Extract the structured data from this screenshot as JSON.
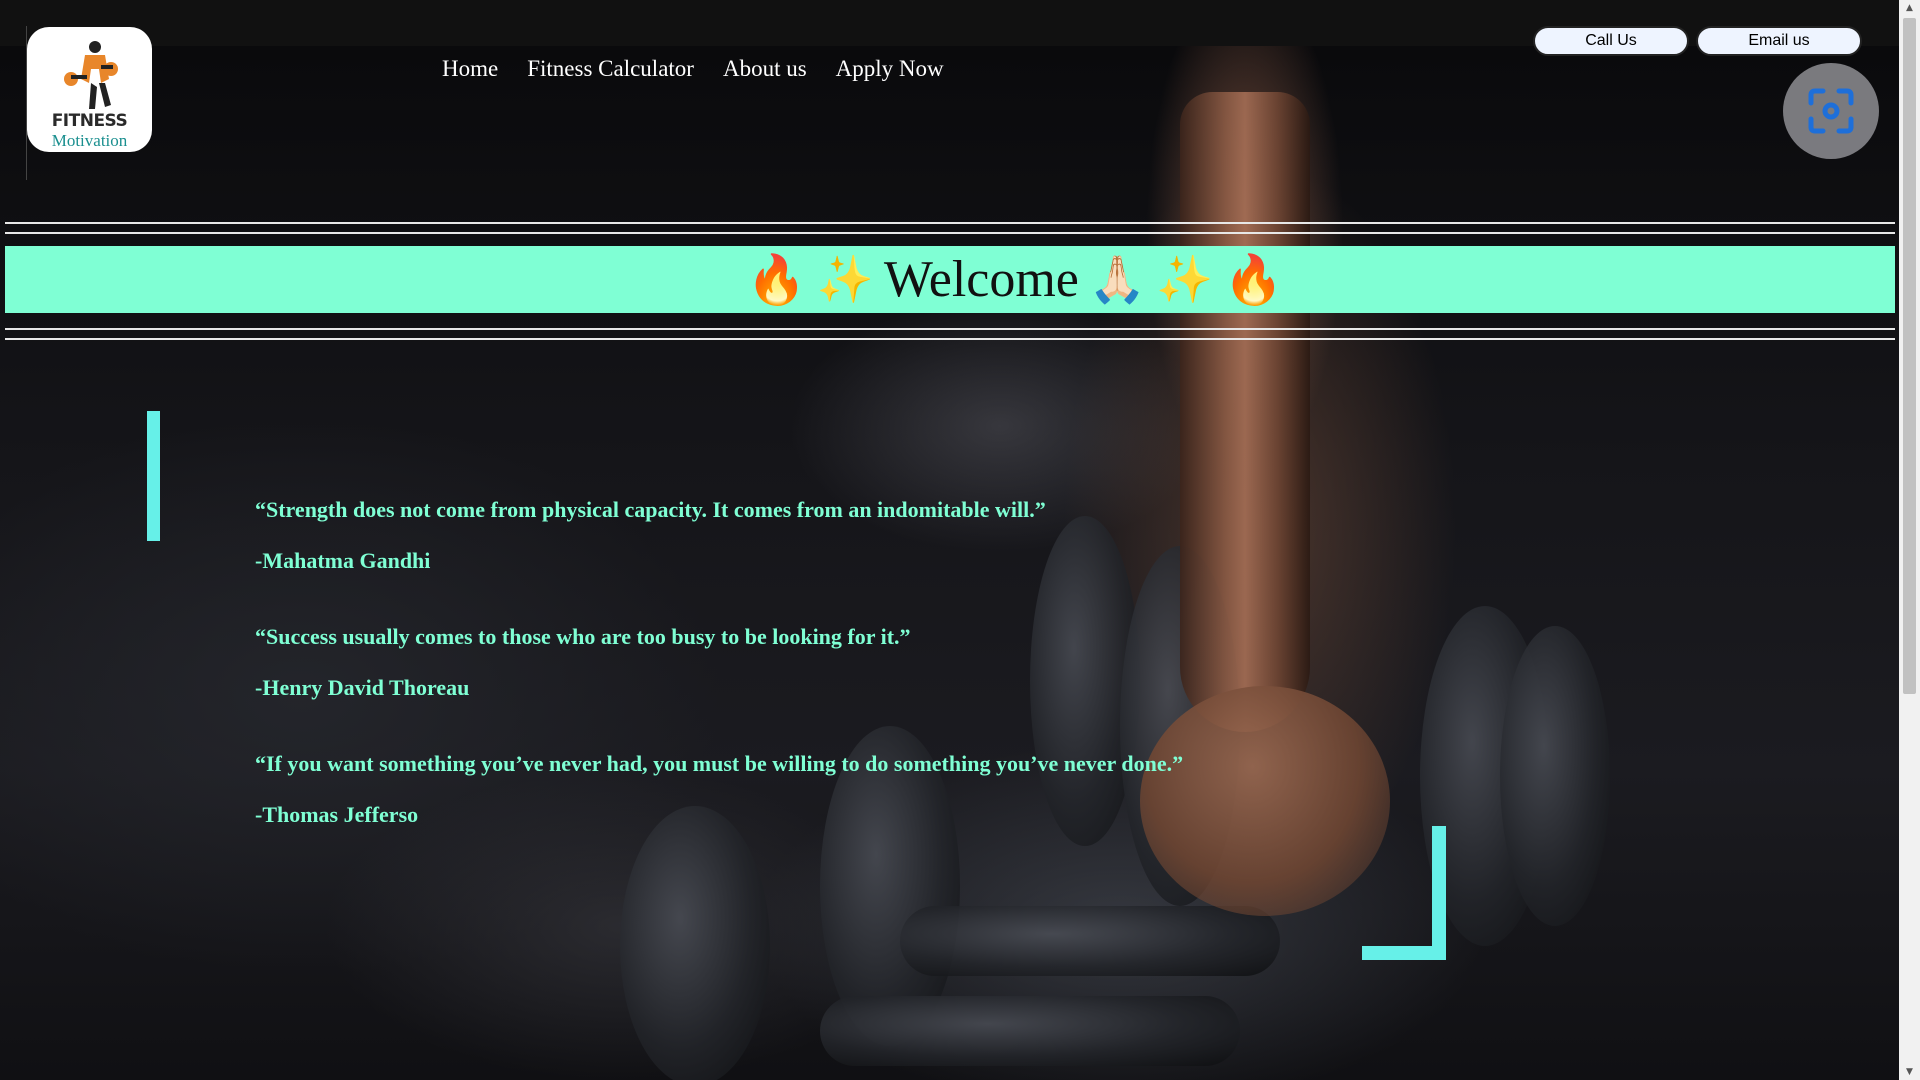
{
  "logo": {
    "title": "FITNESS",
    "subtitle": "Motivation"
  },
  "nav": {
    "items": [
      {
        "label": "Home"
      },
      {
        "label": "Fitness Calculator"
      },
      {
        "label": "About us"
      },
      {
        "label": "Apply Now"
      }
    ]
  },
  "contact": {
    "call_label": "Call Us",
    "email_label": "Email us"
  },
  "welcome": {
    "text": "Welcome",
    "emoji_flame": "🔥",
    "emoji_sparkles": "✨",
    "emoji_hands": "🙏🏻"
  },
  "quotes": [
    {
      "text": "“Strength does not come from physical capacity. It comes from an indomitable will.”",
      "author": "-Mahatma Gandhi"
    },
    {
      "text": "“Success usually comes to those who are too busy to be looking for it.”",
      "author": "-Henry David Thoreau"
    },
    {
      "text": "“If you want something you’ve never had, you must be willing to do something you’ve never done.”",
      "author": "-Thomas Jefferso"
    }
  ],
  "colors": {
    "accent": "#7fffd4",
    "accent_bars": "#66f0e8",
    "topbar": "#111111"
  },
  "icons": {
    "lens": "google-lens-icon",
    "scroll_up": "scroll-up-arrow-icon",
    "scroll_down": "scroll-down-arrow-icon"
  }
}
